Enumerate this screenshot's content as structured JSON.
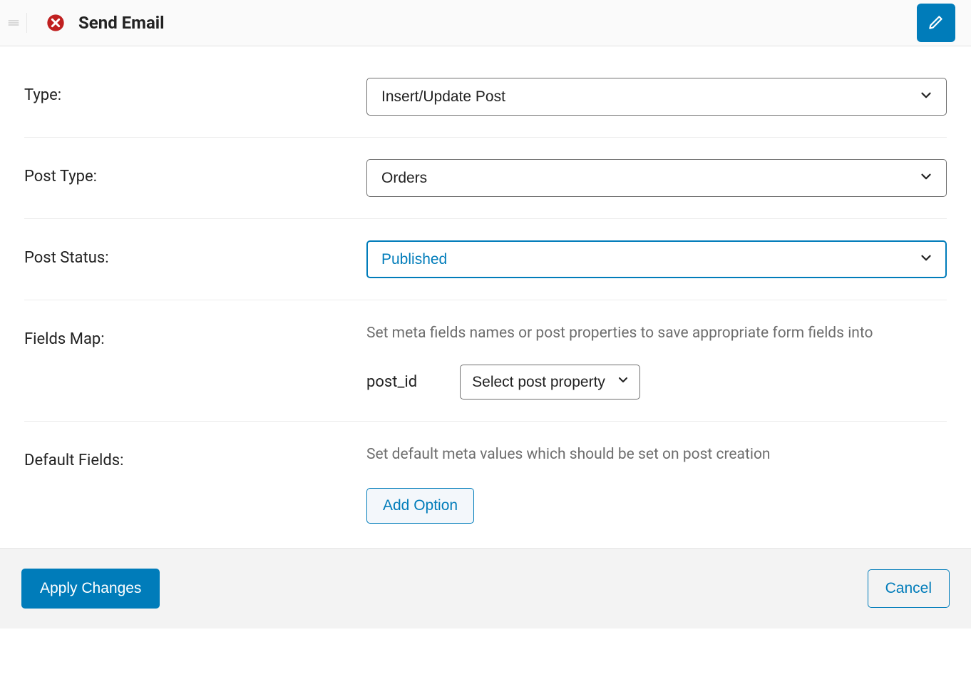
{
  "header": {
    "title": "Send Email"
  },
  "fields": {
    "type": {
      "label": "Type:",
      "value": "Insert/Update Post"
    },
    "post_type": {
      "label": "Post Type:",
      "value": "Orders"
    },
    "post_status": {
      "label": "Post Status:",
      "value": "Published"
    },
    "fields_map": {
      "label": "Fields Map:",
      "helper": "Set meta fields names or post properties to save appropriate form fields into",
      "items": [
        {
          "key": "post_id",
          "value": "Select post property"
        }
      ]
    },
    "default_fields": {
      "label": "Default Fields:",
      "helper": "Set default meta values which should be set on post creation",
      "add_button": "Add Option"
    }
  },
  "footer": {
    "apply": "Apply Changes",
    "cancel": "Cancel"
  }
}
